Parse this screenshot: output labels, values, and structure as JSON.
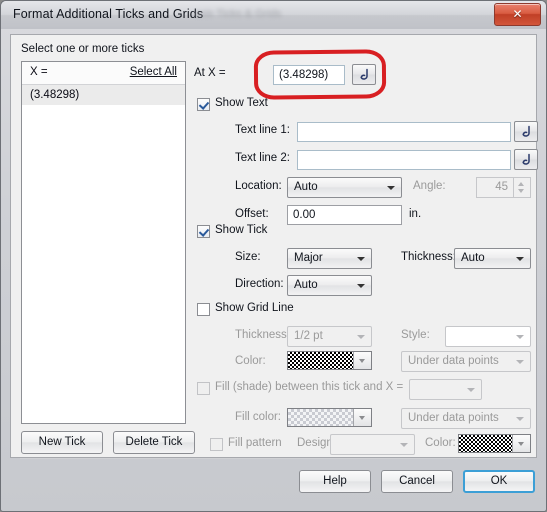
{
  "window": {
    "title": "Format Additional Ticks and Grids",
    "title_suffix_blurred": "axis   Ticks & Grids",
    "close_label": "✕"
  },
  "panel": {
    "select_heading": "Select one or more ticks"
  },
  "tick_list": {
    "column_header": "X =",
    "select_all_label": "Select All",
    "items": [
      "(3.48298)"
    ]
  },
  "at_x": {
    "label": "At X =",
    "value": "(3.48298)",
    "placeholder": "",
    "hook_button_title": "hook"
  },
  "show_text": {
    "label": "Show Text",
    "checked": true,
    "text_line_1_label": "Text line 1:",
    "text_line_1_value": "",
    "text_line_2_label": "Text line 2:",
    "text_line_2_value": "",
    "location_label": "Location:",
    "location_value": "Auto",
    "angle_label": "Angle:",
    "angle_value": "45",
    "offset_label": "Offset:",
    "offset_value": "0.00",
    "offset_units": "in."
  },
  "show_tick": {
    "label": "Show Tick",
    "checked": true,
    "size_label": "Size:",
    "size_value": "Major",
    "thickness_label": "Thickness:",
    "thickness_value": "Auto",
    "direction_label": "Direction:",
    "direction_value": "Auto"
  },
  "show_grid_line": {
    "label": "Show Grid Line",
    "checked": false,
    "thickness_label": "Thickness:",
    "thickness_value": "1/2 pt",
    "style_label": "Style:",
    "style_value": "",
    "color_label": "Color:",
    "color_swatch": "checkerboard-dark",
    "layer_value": "Under data points"
  },
  "fill": {
    "label": "Fill (shade) between this tick and X =",
    "checked": false,
    "target_value": "",
    "fill_color_label": "Fill color:",
    "fill_color_swatch": "checkerboard-light",
    "layer_value": "Under data points",
    "fill_pattern_label": "Fill pattern",
    "fill_pattern_checked": false,
    "design_label": "Design:",
    "design_value": "",
    "pattern_color_label": "Color:",
    "pattern_color_swatch": "checkerboard-dark"
  },
  "tick_buttons": {
    "new_tick": "New Tick",
    "delete_tick": "Delete Tick"
  },
  "footer": {
    "help": "Help",
    "cancel": "Cancel",
    "ok": "OK"
  },
  "annotation": {
    "shape": "red-oval-highlight",
    "color": "#d81f22"
  }
}
